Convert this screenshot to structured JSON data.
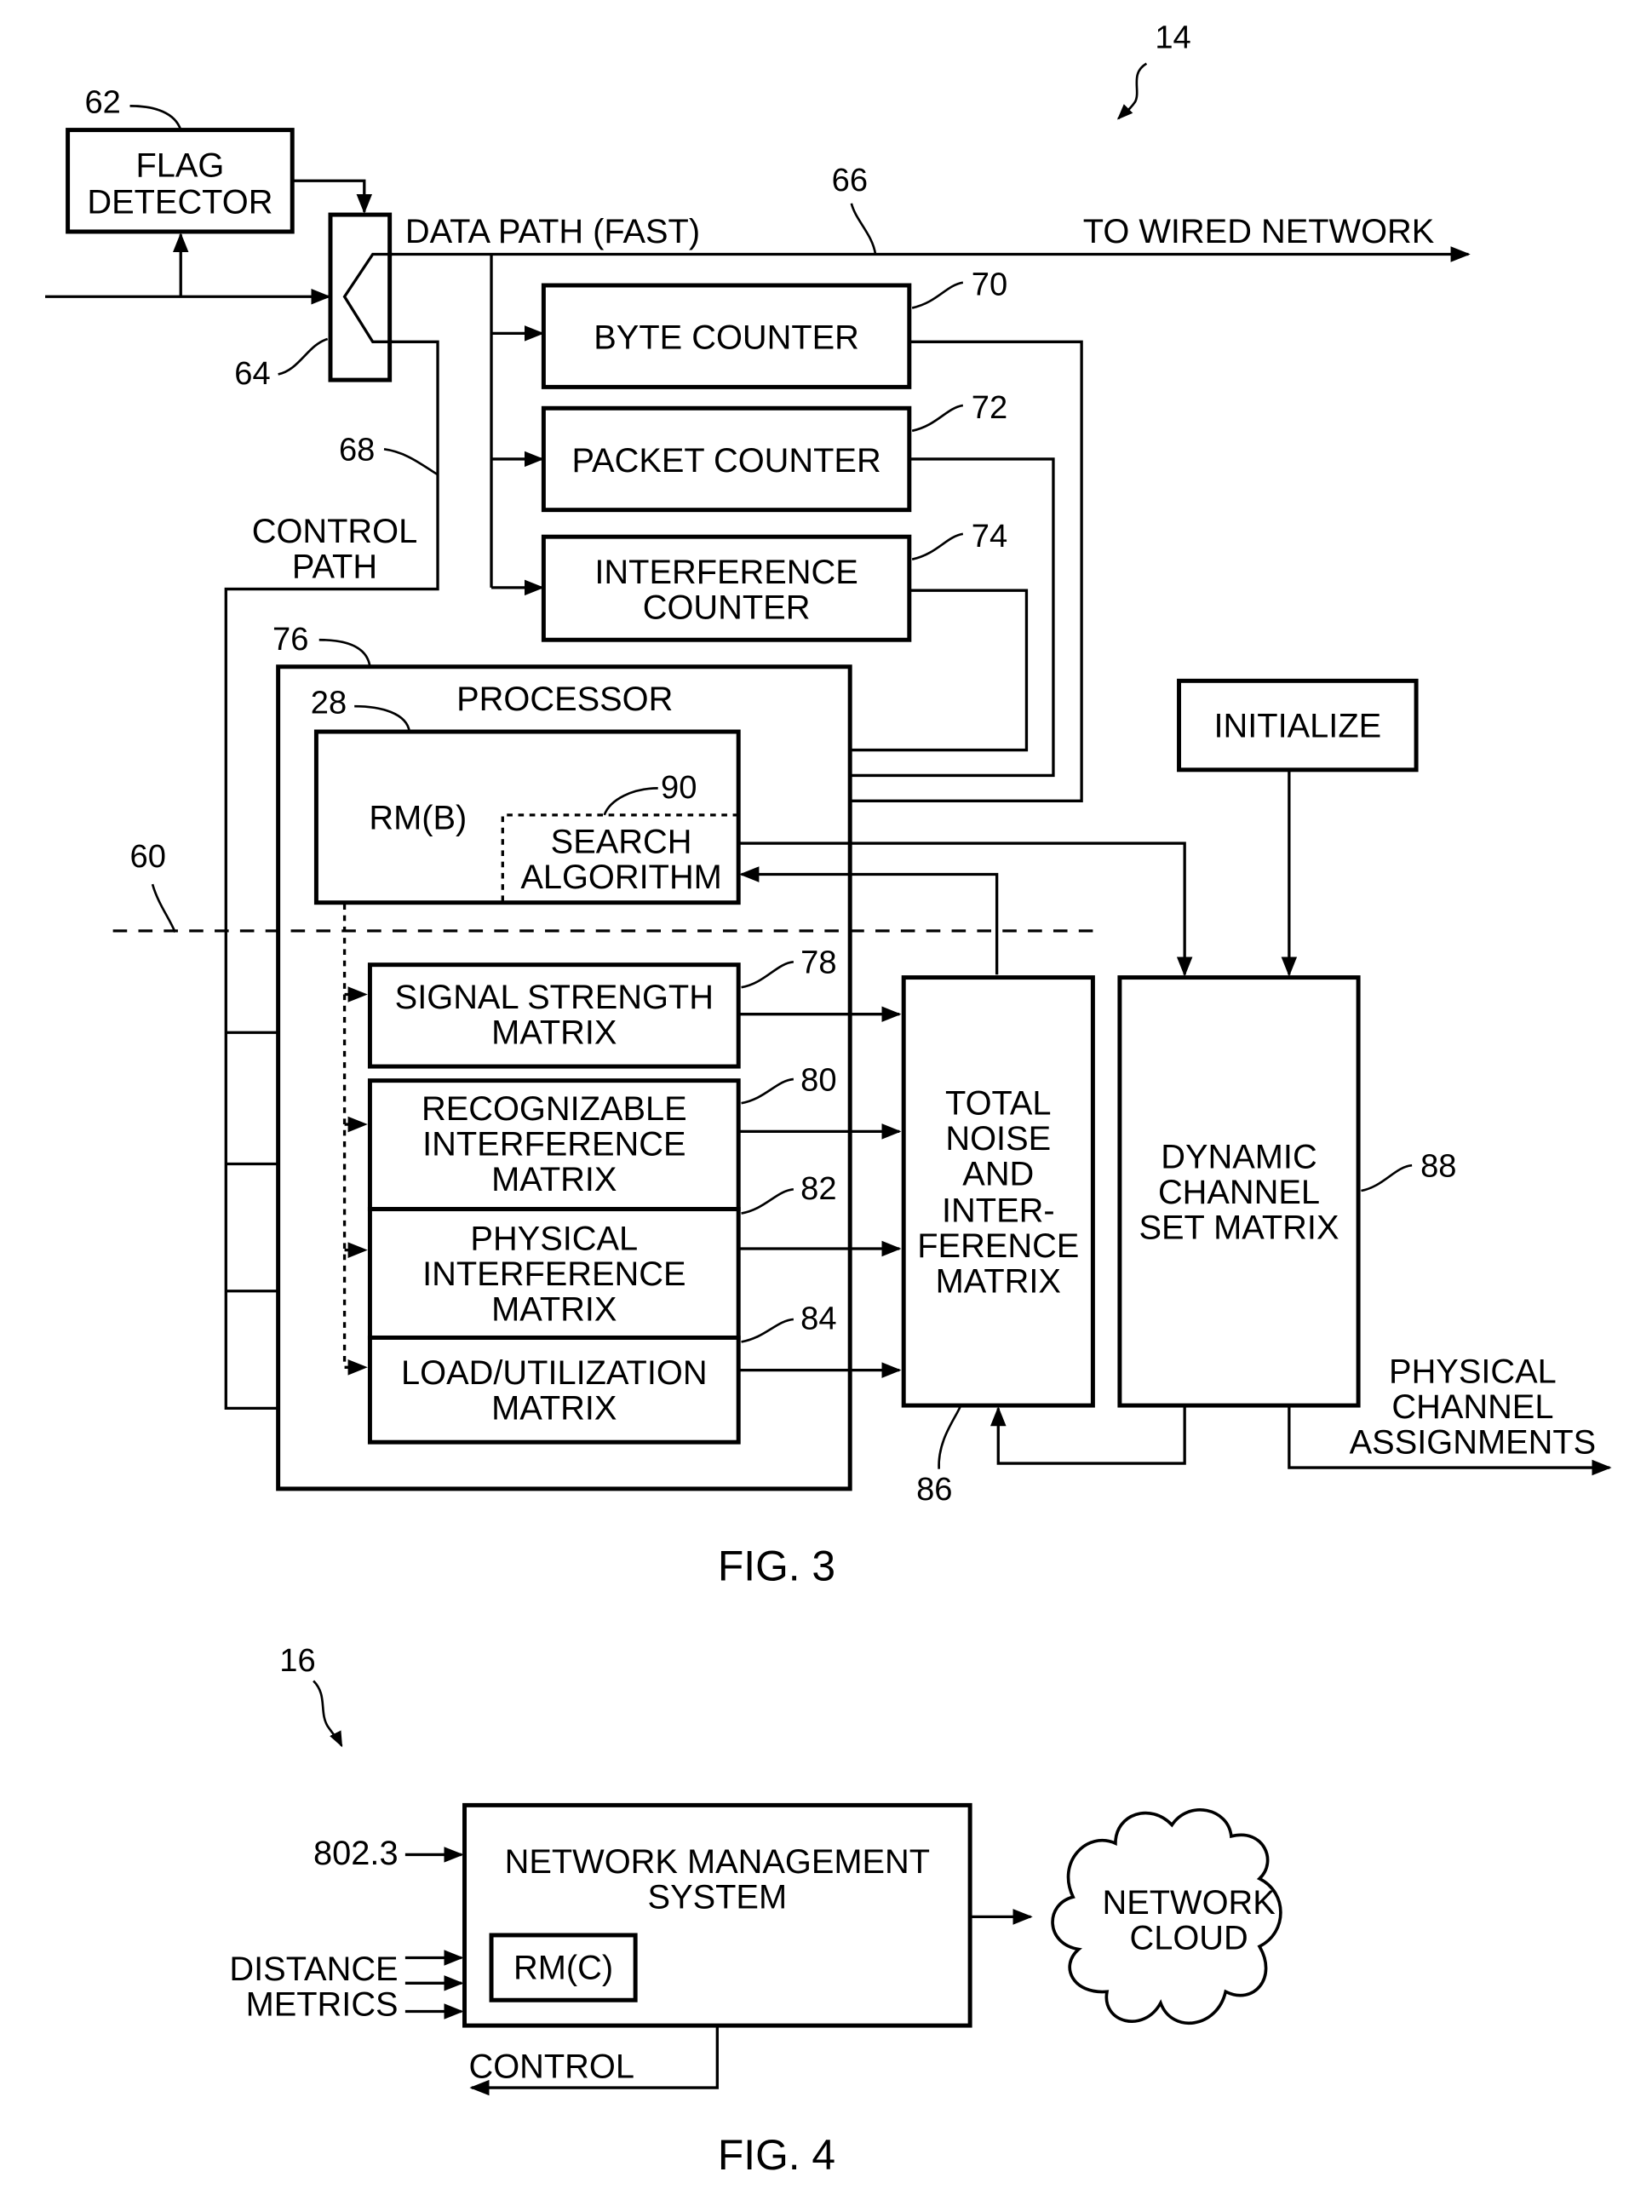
{
  "fig3": {
    "caption": "FIG. 3",
    "ref_main": "14",
    "flag_detector": {
      "ref": "62",
      "line1": "FLAG",
      "line2": "DETECTOR"
    },
    "switch": {
      "ref": "64"
    },
    "data_path": {
      "label": "DATA PATH (FAST)",
      "ref": "66",
      "destination": "TO WIRED NETWORK"
    },
    "control_path": {
      "ref": "68",
      "line1": "CONTROL",
      "line2": "PATH"
    },
    "byte_counter": {
      "ref": "70",
      "label": "BYTE COUNTER"
    },
    "packet_counter": {
      "ref": "72",
      "label": "PACKET COUNTER"
    },
    "interference_counter": {
      "ref": "74",
      "line1": "INTERFERENCE",
      "line2": "COUNTER"
    },
    "processor": {
      "ref": "76",
      "label": "PROCESSOR"
    },
    "rm_b": {
      "ref": "28",
      "label": "RM(B)"
    },
    "search_algorithm": {
      "ref": "90",
      "line1": "SEARCH",
      "line2": "ALGORITHM"
    },
    "boundary": {
      "ref": "60"
    },
    "signal_strength_matrix": {
      "ref": "78",
      "line1": "SIGNAL STRENGTH",
      "line2": "MATRIX"
    },
    "recognizable_interference_matrix": {
      "ref": "80",
      "line1": "RECOGNIZABLE",
      "line2": "INTERFERENCE",
      "line3": "MATRIX"
    },
    "physical_interference_matrix": {
      "ref": "82",
      "line1": "PHYSICAL",
      "line2": "INTERFERENCE",
      "line3": "MATRIX"
    },
    "load_utilization_matrix": {
      "ref": "84",
      "line1": "LOAD/UTILIZATION",
      "line2": "MATRIX"
    },
    "total_noise_matrix": {
      "ref": "86",
      "lines": [
        "TOTAL",
        "NOISE",
        "AND",
        "INTER-",
        "FERENCE",
        "MATRIX"
      ]
    },
    "dynamic_channel_set_matrix": {
      "ref": "88",
      "lines": [
        "DYNAMIC",
        "CHANNEL",
        "SET MATRIX"
      ]
    },
    "initialize": {
      "label": "INITIALIZE"
    },
    "output": {
      "line1": "PHYSICAL",
      "line2": "CHANNEL",
      "line3": "ASSIGNMENTS"
    }
  },
  "fig4": {
    "caption": "FIG. 4",
    "ref_main": "16",
    "nms": {
      "line1": "NETWORK MANAGEMENT",
      "line2": "SYSTEM"
    },
    "rm_c": {
      "label": "RM(C)"
    },
    "input_8023": "802.3",
    "distance_metrics": {
      "line1": "DISTANCE",
      "line2": "METRICS"
    },
    "control": "CONTROL",
    "cloud": {
      "line1": "NETWORK",
      "line2": "CLOUD"
    }
  }
}
